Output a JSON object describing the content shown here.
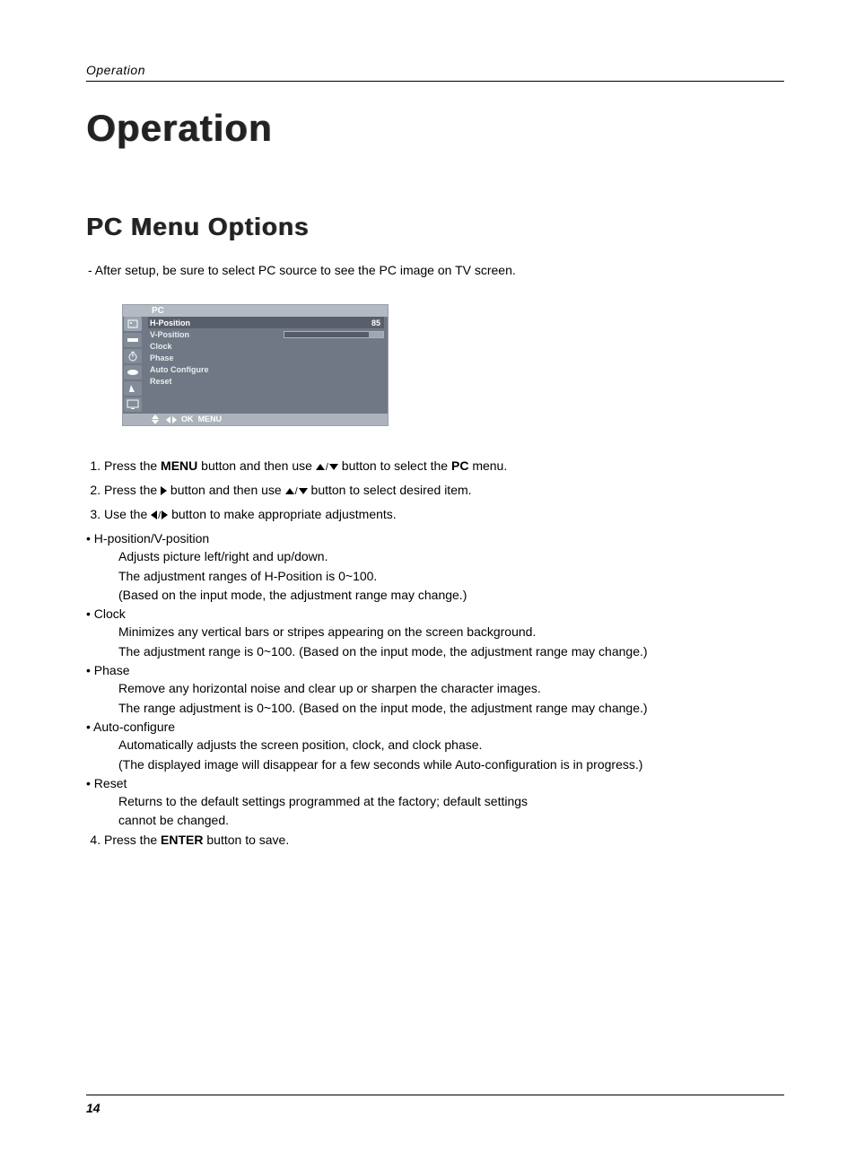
{
  "running_head": "Operation",
  "h1": "Operation",
  "h2": "PC Menu Options",
  "intro": "- After setup, be sure to select PC source to see the PC image on TV screen.",
  "osd": {
    "title": "PC",
    "rows": [
      {
        "label": "H-Position",
        "value": "85",
        "selected": true
      },
      {
        "label": "V-Position"
      },
      {
        "label": "Clock"
      },
      {
        "label": "Phase"
      },
      {
        "label": "Auto Configure"
      },
      {
        "label": "Reset"
      }
    ],
    "footer_ok": "OK",
    "footer_menu": "MENU"
  },
  "steps": {
    "s1_a": "Press the ",
    "s1_menu": "MENU",
    "s1_b": " button and then use ",
    "s1_c": " button to select the ",
    "s1_pc": "PC",
    "s1_d": " menu.",
    "s2_a": "Press the ",
    "s2_b": " button and then use ",
    "s2_c": " button to select desired item.",
    "s3_a": "Use the ",
    "s3_b": " button to make appropriate adjustments."
  },
  "bullets": {
    "hpos_head": "• H-position/V-position",
    "hpos_l1": "Adjusts picture left/right and up/down.",
    "hpos_l2": "The adjustment ranges of H-Position is 0~100.",
    "hpos_l3": "(Based on the input mode, the adjustment range may change.)",
    "clock_head": "• Clock",
    "clock_l1": "Minimizes any vertical bars or stripes appearing on the screen background.",
    "clock_l2": "The adjustment range is 0~100. (Based on the input mode, the adjustment range may change.)",
    "phase_head": "• Phase",
    "phase_l1": "Remove any horizontal noise and clear up or sharpen the character images.",
    "phase_l2": "The range adjustment is 0~100. (Based on the input mode, the adjustment range may change.)",
    "auto_head": "• Auto-configure",
    "auto_l1": "Automatically adjusts the screen position, clock, and clock phase.",
    "auto_l2": "(The displayed image will disappear for a few seconds while Auto-configuration is in progress.)",
    "reset_head": "• Reset",
    "reset_l1": "Returns to the default settings programmed at the factory; default settings",
    "reset_l2": "cannot be changed."
  },
  "step4_a": "Press the ",
  "step4_enter": "ENTER",
  "step4_b": " button to save.",
  "page_number": "14"
}
